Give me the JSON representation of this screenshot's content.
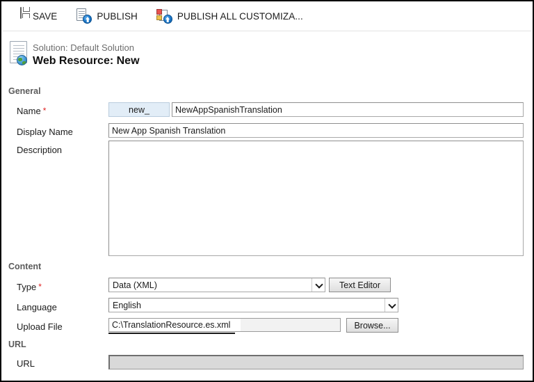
{
  "toolbar": {
    "buttons": [
      {
        "label": "SAVE",
        "icon": "save-floppy-icon"
      },
      {
        "label": "PUBLISH",
        "icon": "publish-document-upload-icon"
      },
      {
        "label": "PUBLISH ALL CUSTOMIZA...",
        "icon": "publish-all-customizations-icon"
      }
    ]
  },
  "record_header": {
    "icon": "web-resource-globe-document-icon",
    "subtitle": "Solution: Default Solution",
    "title": "Web Resource: New"
  },
  "sections": {
    "general": {
      "title": "General",
      "name": {
        "label": "Name",
        "required": true,
        "prefix": "new_",
        "value": "NewAppSpanishTranslation"
      },
      "display_name": {
        "label": "Display Name",
        "value": "New App Spanish Translation"
      },
      "description": {
        "label": "Description",
        "value": ""
      }
    },
    "content": {
      "title": "Content",
      "type": {
        "label": "Type",
        "required": true,
        "value": "Data (XML)"
      },
      "text_editor_button": "Text Editor",
      "language": {
        "label": "Language",
        "value": "English"
      },
      "upload_file": {
        "label": "Upload File",
        "value": "C:\\TranslationResource.es.xml",
        "browse_button": "Browse..."
      }
    },
    "url": {
      "title": "URL",
      "url": {
        "label": "URL",
        "value": ""
      }
    }
  },
  "colors": {
    "accent_blue": "#1976c8",
    "required_red": "#e02020",
    "prefix_bg": "#e2edf7",
    "readonly_bg": "#d9d9d9",
    "section_label": "#5b5b5b"
  }
}
